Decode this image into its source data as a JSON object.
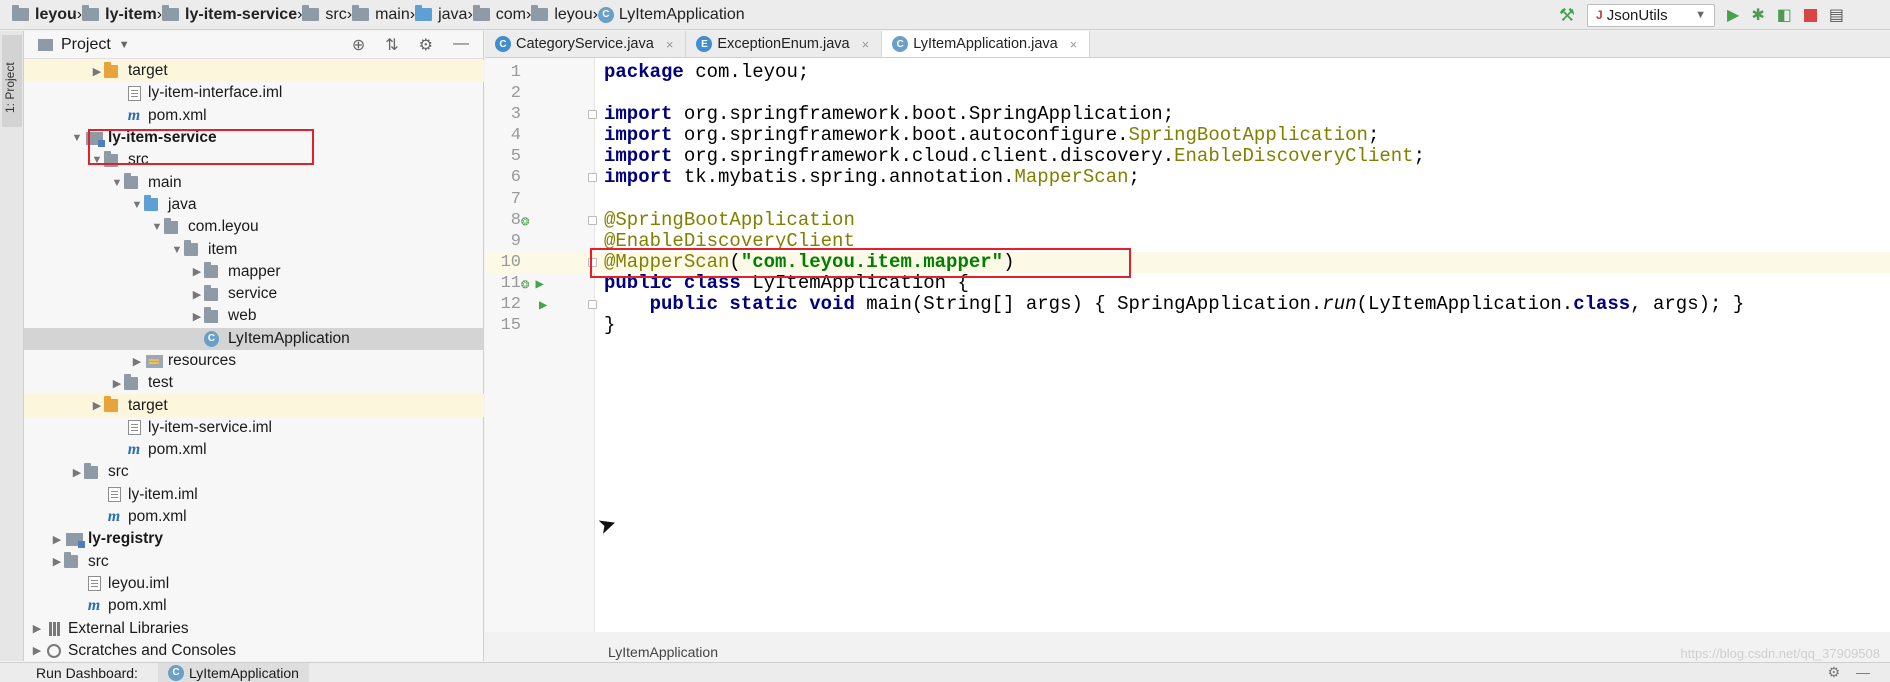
{
  "breadcrumbs": [
    {
      "label": "leyou",
      "icon": "project-folder-icon"
    },
    {
      "label": "ly-item",
      "icon": "module-folder-icon"
    },
    {
      "label": "ly-item-service",
      "icon": "module-folder-icon"
    },
    {
      "label": "src",
      "icon": "folder-icon"
    },
    {
      "label": "main",
      "icon": "folder-icon"
    },
    {
      "label": "java",
      "icon": "source-folder-icon"
    },
    {
      "label": "com",
      "icon": "package-icon"
    },
    {
      "label": "leyou",
      "icon": "package-icon"
    },
    {
      "label": "LyItemApplication",
      "icon": "spring-class-icon"
    }
  ],
  "toolbar": {
    "run_config": "JsonUtils"
  },
  "sidebar_stripe": {
    "label": "1: Project"
  },
  "project_panel": {
    "title": "Project",
    "tree": [
      {
        "label": "target",
        "indent": 3,
        "arrow": "right",
        "icon": "folder-orange",
        "highlight": "yellow"
      },
      {
        "label": "ly-item-interface.iml",
        "indent": 4,
        "arrow": "none",
        "icon": "iml"
      },
      {
        "label": "pom.xml",
        "indent": 4,
        "arrow": "none",
        "icon": "maven"
      },
      {
        "label": "ly-item-service",
        "indent": 2,
        "arrow": "down",
        "icon": "module",
        "bold": true
      },
      {
        "label": "src",
        "indent": 3,
        "arrow": "down",
        "icon": "folder"
      },
      {
        "label": "main",
        "indent": 4,
        "arrow": "down",
        "icon": "folder"
      },
      {
        "label": "java",
        "indent": 5,
        "arrow": "down",
        "icon": "folder-blue"
      },
      {
        "label": "com.leyou",
        "indent": 6,
        "arrow": "down",
        "icon": "folder"
      },
      {
        "label": "item",
        "indent": 7,
        "arrow": "down",
        "icon": "folder"
      },
      {
        "label": "mapper",
        "indent": 8,
        "arrow": "right",
        "icon": "folder"
      },
      {
        "label": "service",
        "indent": 8,
        "arrow": "right",
        "icon": "folder"
      },
      {
        "label": "web",
        "indent": 8,
        "arrow": "right",
        "icon": "folder"
      },
      {
        "label": "LyItemApplication",
        "indent": 8,
        "arrow": "none",
        "icon": "class",
        "highlight": "gray"
      },
      {
        "label": "resources",
        "indent": 5,
        "arrow": "right",
        "icon": "resources"
      },
      {
        "label": "test",
        "indent": 4,
        "arrow": "right",
        "icon": "folder"
      },
      {
        "label": "target",
        "indent": 3,
        "arrow": "right",
        "icon": "folder-orange",
        "highlight": "yellow"
      },
      {
        "label": "ly-item-service.iml",
        "indent": 4,
        "arrow": "none",
        "icon": "iml"
      },
      {
        "label": "pom.xml",
        "indent": 4,
        "arrow": "none",
        "icon": "maven"
      },
      {
        "label": "src",
        "indent": 2,
        "arrow": "right",
        "icon": "folder"
      },
      {
        "label": "ly-item.iml",
        "indent": 3,
        "arrow": "none",
        "icon": "iml"
      },
      {
        "label": "pom.xml",
        "indent": 3,
        "arrow": "none",
        "icon": "maven"
      },
      {
        "label": "ly-registry",
        "indent": 1,
        "arrow": "right",
        "icon": "module",
        "bold": true
      },
      {
        "label": "src",
        "indent": 1,
        "arrow": "right",
        "icon": "folder"
      },
      {
        "label": "leyou.iml",
        "indent": 2,
        "arrow": "none",
        "icon": "iml"
      },
      {
        "label": "pom.xml",
        "indent": 2,
        "arrow": "none",
        "icon": "maven"
      },
      {
        "label": "External Libraries",
        "indent": 0,
        "arrow": "right",
        "icon": "library"
      },
      {
        "label": "Scratches and Consoles",
        "indent": 0,
        "arrow": "right",
        "icon": "scratch"
      }
    ]
  },
  "editor_tabs": [
    {
      "label": "CategoryService.java",
      "active": false
    },
    {
      "label": "ExceptionEnum.java",
      "active": false
    },
    {
      "label": "LyItemApplication.java",
      "active": true
    }
  ],
  "code_lines": [
    {
      "num": "1",
      "html": "<span class='kw'>package</span> com.leyou;"
    },
    {
      "num": "2",
      "html": ""
    },
    {
      "num": "3",
      "html": "<span class='kw'>import</span> org.springframework.boot.SpringApplication;",
      "fold": true
    },
    {
      "num": "4",
      "html": "<span class='kw'>import</span> org.springframework.boot.autoconfigure.<span class='ann'>SpringBootApplication</span>;"
    },
    {
      "num": "5",
      "html": "<span class='kw'>import</span> org.springframework.cloud.client.discovery.<span class='ann'>EnableDiscoveryClient</span>;"
    },
    {
      "num": "6",
      "html": "<span class='kw'>import</span> tk.mybatis.spring.annotation.<span class='ann'>MapperScan</span>;",
      "fold": true
    },
    {
      "num": "7",
      "html": ""
    },
    {
      "num": "8",
      "html": "<span class='ann'>@SpringBootApplication</span>",
      "fold": true,
      "gicon": "bean"
    },
    {
      "num": "9",
      "html": "<span class='ann'>@EnableDiscoveryClient</span>"
    },
    {
      "num": "10",
      "html": "<span class='ann'>@MapperScan</span>(<span class='str'>\"com.leyou.item.mapper\"</span>)",
      "fold": true,
      "caret": true
    },
    {
      "num": "11",
      "html": "<span class='kw'>public class</span> LyItemApplication {",
      "gicon": "run-bean"
    },
    {
      "num": "12",
      "html": "    <span class='kw'>public static void</span> main(String[] args) { SpringApplication.<span class='it'>run</span>(LyItemApplication.<span class='kw'>class</span>, args); }",
      "fold": true,
      "gicon": "run"
    },
    {
      "num": "15",
      "html": "}"
    }
  ],
  "code_breadcrumb": "LyItemApplication",
  "bottom": {
    "run_dashboard": "Run Dashboard:",
    "run_app": "LyItemApplication"
  },
  "watermark": "https://blog.csdn.net/qq_37909508"
}
